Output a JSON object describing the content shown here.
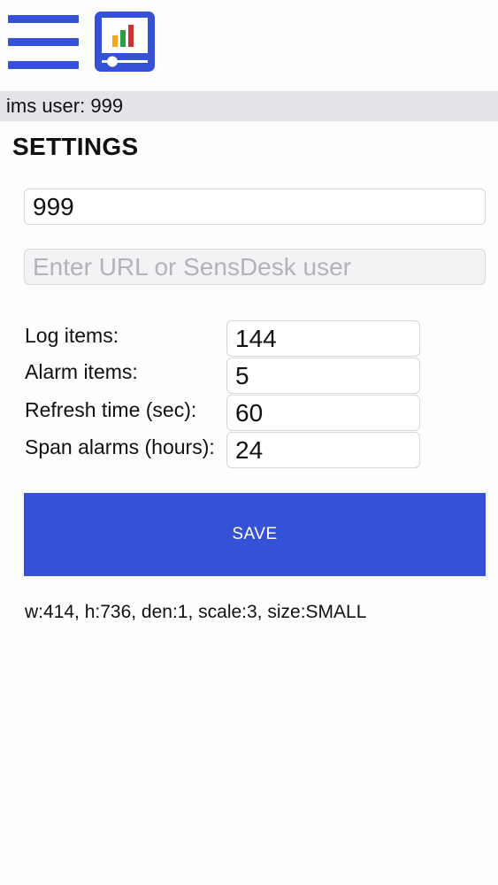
{
  "header": {
    "menu_icon": "hamburger-menu-icon",
    "app_icon": "chart-monitor-icon",
    "accent_color": "#3451d8",
    "icon_bar_colors": [
      "#f4a623",
      "#2e9e44",
      "#d0312d"
    ]
  },
  "user_bar": {
    "text": "ims user: 999"
  },
  "settings": {
    "title": "SETTINGS",
    "user_field": {
      "value": "999",
      "placeholder": ""
    },
    "url_field": {
      "value": "",
      "placeholder": "Enter URL or SensDesk user"
    },
    "rows": [
      {
        "label": "Log items:",
        "value": "144"
      },
      {
        "label": "Alarm items:",
        "value": "5"
      },
      {
        "label": "Refresh time (sec):",
        "value": "60"
      },
      {
        "label": "Span alarms (hours):",
        "value": "24"
      }
    ],
    "save_label": "SAVE"
  },
  "device_info": {
    "text": "w:414, h:736, den:1, scale:3, size:SMALL"
  }
}
